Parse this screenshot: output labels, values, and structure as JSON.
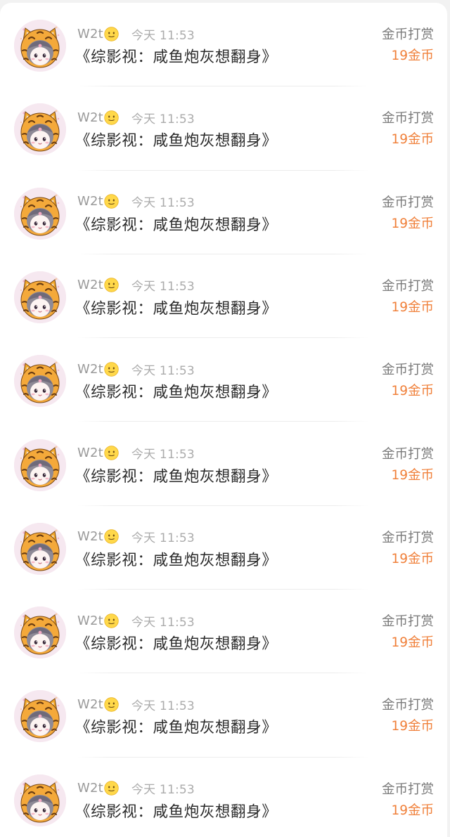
{
  "records": [
    {
      "username": "W2t",
      "emoji": "sweat-smile-emoji-icon",
      "time": "今天 11:53",
      "book": "《综影视：咸鱼炮灰想翻身》",
      "type": "金币打赏",
      "amount": "19金币"
    },
    {
      "username": "W2t",
      "emoji": "sweat-smile-emoji-icon",
      "time": "今天 11:53",
      "book": "《综影视：咸鱼炮灰想翻身》",
      "type": "金币打赏",
      "amount": "19金币"
    },
    {
      "username": "W2t",
      "emoji": "sweat-smile-emoji-icon",
      "time": "今天 11:53",
      "book": "《综影视：咸鱼炮灰想翻身》",
      "type": "金币打赏",
      "amount": "19金币"
    },
    {
      "username": "W2t",
      "emoji": "sweat-smile-emoji-icon",
      "time": "今天 11:53",
      "book": "《综影视：咸鱼炮灰想翻身》",
      "type": "金币打赏",
      "amount": "19金币"
    },
    {
      "username": "W2t",
      "emoji": "sweat-smile-emoji-icon",
      "time": "今天 11:53",
      "book": "《综影视：咸鱼炮灰想翻身》",
      "type": "金币打赏",
      "amount": "19金币"
    },
    {
      "username": "W2t",
      "emoji": "sweat-smile-emoji-icon",
      "time": "今天 11:53",
      "book": "《综影视：咸鱼炮灰想翻身》",
      "type": "金币打赏",
      "amount": "19金币"
    },
    {
      "username": "W2t",
      "emoji": "sweat-smile-emoji-icon",
      "time": "今天 11:53",
      "book": "《综影视：咸鱼炮灰想翻身》",
      "type": "金币打赏",
      "amount": "19金币"
    },
    {
      "username": "W2t",
      "emoji": "sweat-smile-emoji-icon",
      "time": "今天 11:53",
      "book": "《综影视：咸鱼炮灰想翻身》",
      "type": "金币打赏",
      "amount": "19金币"
    },
    {
      "username": "W2t",
      "emoji": "sweat-smile-emoji-icon",
      "time": "今天 11:53",
      "book": "《综影视：咸鱼炮灰想翻身》",
      "type": "金币打赏",
      "amount": "19金币"
    },
    {
      "username": "W2t",
      "emoji": "sweat-smile-emoji-icon",
      "time": "今天 11:53",
      "book": "《综影视：咸鱼炮灰想翻身》",
      "type": "金币打赏",
      "amount": "19金币"
    }
  ],
  "colors": {
    "amount": "#f0803a",
    "username": "#9a9a9a",
    "title": "#2a2a2a",
    "background": "#f2f2f2"
  },
  "icons": {
    "avatar": "tiger-hood-avatar-icon",
    "emoji": "sweat-smile-emoji-icon"
  }
}
